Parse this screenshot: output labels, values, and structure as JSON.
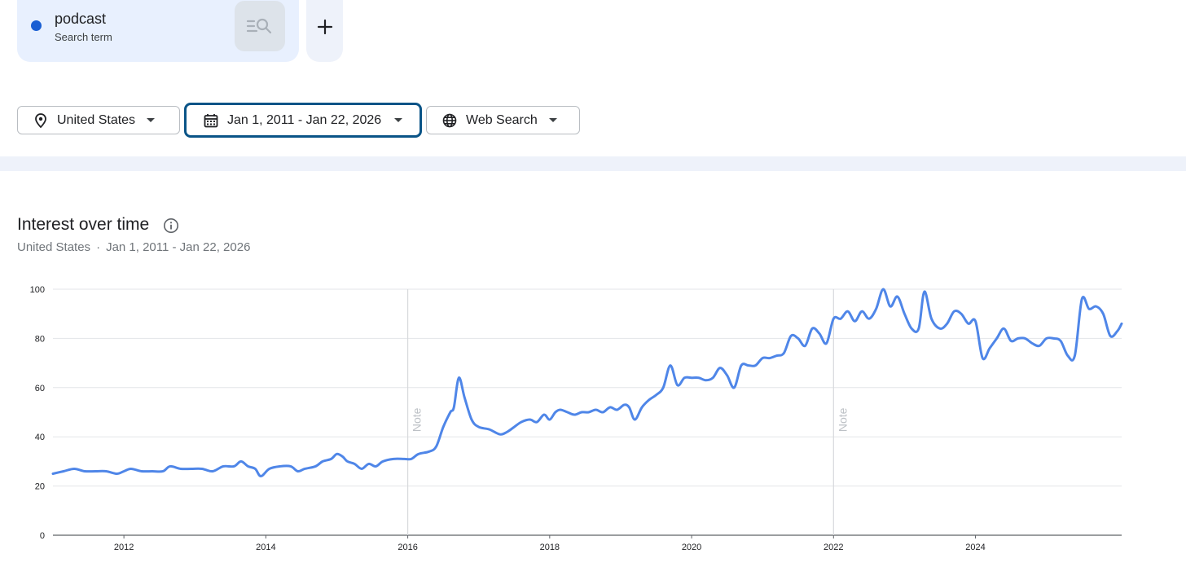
{
  "term": {
    "name": "podcast",
    "type": "Search term",
    "color": "#1a5fd3",
    "action_icon": "search-list-icon",
    "add_icon": "plus-icon"
  },
  "filters": {
    "region": {
      "label": "United States",
      "icon": "location-pin-icon"
    },
    "date_range": {
      "label": "Jan 1, 2011 - Jan 22, 2026",
      "icon": "calendar-icon",
      "selected": true
    },
    "property": {
      "label": "Web Search",
      "icon": "globe-icon"
    }
  },
  "section": {
    "title": "Interest over time",
    "subtitle_region": "United States",
    "subtitle_separator": "·",
    "subtitle_dates": "Jan 1, 2011 - Jan 22, 2026",
    "info_icon": "info-icon"
  },
  "chart_data": {
    "type": "line",
    "title": "",
    "xlabel": "",
    "ylabel": "",
    "xlim": [
      2011,
      2026.06
    ],
    "ylim": [
      0,
      100
    ],
    "y_ticks": [
      0,
      20,
      40,
      60,
      80,
      100
    ],
    "x_ticks": [
      "2012",
      "2014",
      "2016",
      "2018",
      "2020",
      "2022",
      "2024"
    ],
    "grid": true,
    "line_color": "#4f86e8",
    "notes": [
      {
        "x": 2016.0,
        "label": "Note"
      },
      {
        "x": 2022.0,
        "label": "Note"
      }
    ],
    "series": [
      {
        "name": "podcast",
        "points": [
          [
            2011.0,
            25
          ],
          [
            2011.15,
            26
          ],
          [
            2011.3,
            27
          ],
          [
            2011.45,
            26
          ],
          [
            2011.6,
            26
          ],
          [
            2011.75,
            26
          ],
          [
            2011.9,
            25
          ],
          [
            2012.0,
            26
          ],
          [
            2012.1,
            27
          ],
          [
            2012.25,
            26
          ],
          [
            2012.4,
            26
          ],
          [
            2012.55,
            26
          ],
          [
            2012.65,
            28
          ],
          [
            2012.8,
            27
          ],
          [
            2012.95,
            27
          ],
          [
            2013.1,
            27
          ],
          [
            2013.25,
            26
          ],
          [
            2013.4,
            28
          ],
          [
            2013.55,
            28
          ],
          [
            2013.65,
            30
          ],
          [
            2013.75,
            28
          ],
          [
            2013.85,
            27
          ],
          [
            2013.93,
            24
          ],
          [
            2014.05,
            27
          ],
          [
            2014.2,
            28
          ],
          [
            2014.35,
            28
          ],
          [
            2014.45,
            26
          ],
          [
            2014.55,
            27
          ],
          [
            2014.7,
            28
          ],
          [
            2014.8,
            30
          ],
          [
            2014.92,
            31
          ],
          [
            2015.0,
            33
          ],
          [
            2015.08,
            32
          ],
          [
            2015.15,
            30
          ],
          [
            2015.25,
            29
          ],
          [
            2015.35,
            27
          ],
          [
            2015.45,
            29
          ],
          [
            2015.55,
            28
          ],
          [
            2015.65,
            30
          ],
          [
            2015.8,
            31
          ],
          [
            2015.95,
            31
          ],
          [
            2016.05,
            31
          ],
          [
            2016.15,
            33
          ],
          [
            2016.3,
            34
          ],
          [
            2016.4,
            36
          ],
          [
            2016.5,
            44
          ],
          [
            2016.6,
            50
          ],
          [
            2016.65,
            52
          ],
          [
            2016.72,
            64
          ],
          [
            2016.8,
            56
          ],
          [
            2016.9,
            47
          ],
          [
            2017.0,
            44
          ],
          [
            2017.15,
            43
          ],
          [
            2017.3,
            41
          ],
          [
            2017.4,
            42
          ],
          [
            2017.5,
            44
          ],
          [
            2017.6,
            46
          ],
          [
            2017.72,
            47
          ],
          [
            2017.82,
            46
          ],
          [
            2017.92,
            49
          ],
          [
            2018.0,
            47
          ],
          [
            2018.08,
            50
          ],
          [
            2018.15,
            51
          ],
          [
            2018.25,
            50
          ],
          [
            2018.35,
            49
          ],
          [
            2018.45,
            50
          ],
          [
            2018.55,
            50
          ],
          [
            2018.65,
            51
          ],
          [
            2018.75,
            50
          ],
          [
            2018.85,
            52
          ],
          [
            2018.95,
            51
          ],
          [
            2019.05,
            53
          ],
          [
            2019.12,
            52
          ],
          [
            2019.2,
            47
          ],
          [
            2019.3,
            52
          ],
          [
            2019.4,
            55
          ],
          [
            2019.5,
            57
          ],
          [
            2019.6,
            60
          ],
          [
            2019.7,
            69
          ],
          [
            2019.8,
            61
          ],
          [
            2019.9,
            64
          ],
          [
            2020.0,
            64
          ],
          [
            2020.1,
            64
          ],
          [
            2020.2,
            63
          ],
          [
            2020.3,
            64
          ],
          [
            2020.4,
            68
          ],
          [
            2020.5,
            65
          ],
          [
            2020.6,
            60
          ],
          [
            2020.7,
            69
          ],
          [
            2020.8,
            69
          ],
          [
            2020.9,
            69
          ],
          [
            2021.0,
            72
          ],
          [
            2021.1,
            72
          ],
          [
            2021.2,
            73
          ],
          [
            2021.3,
            74
          ],
          [
            2021.4,
            81
          ],
          [
            2021.5,
            80
          ],
          [
            2021.6,
            77
          ],
          [
            2021.7,
            84
          ],
          [
            2021.8,
            82
          ],
          [
            2021.9,
            78
          ],
          [
            2022.0,
            88
          ],
          [
            2022.1,
            88
          ],
          [
            2022.2,
            91
          ],
          [
            2022.3,
            87
          ],
          [
            2022.4,
            91
          ],
          [
            2022.5,
            88
          ],
          [
            2022.6,
            92
          ],
          [
            2022.7,
            100
          ],
          [
            2022.8,
            93
          ],
          [
            2022.9,
            97
          ],
          [
            2023.0,
            90
          ],
          [
            2023.1,
            84
          ],
          [
            2023.2,
            84
          ],
          [
            2023.28,
            99
          ],
          [
            2023.38,
            88
          ],
          [
            2023.5,
            84
          ],
          [
            2023.6,
            86
          ],
          [
            2023.7,
            91
          ],
          [
            2023.8,
            90
          ],
          [
            2023.9,
            86
          ],
          [
            2024.0,
            87
          ],
          [
            2024.1,
            72
          ],
          [
            2024.2,
            76
          ],
          [
            2024.3,
            80
          ],
          [
            2024.4,
            84
          ],
          [
            2024.5,
            79
          ],
          [
            2024.6,
            80
          ],
          [
            2024.7,
            80
          ],
          [
            2024.8,
            78
          ],
          [
            2024.9,
            77
          ],
          [
            2025.0,
            80
          ],
          [
            2025.1,
            80
          ],
          [
            2025.2,
            79
          ],
          [
            2025.3,
            73
          ],
          [
            2025.4,
            73
          ],
          [
            2025.5,
            96
          ],
          [
            2025.6,
            92
          ],
          [
            2025.7,
            93
          ],
          [
            2025.8,
            90
          ],
          [
            2025.9,
            81
          ],
          [
            2026.0,
            83
          ],
          [
            2026.06,
            86
          ]
        ]
      }
    ]
  }
}
